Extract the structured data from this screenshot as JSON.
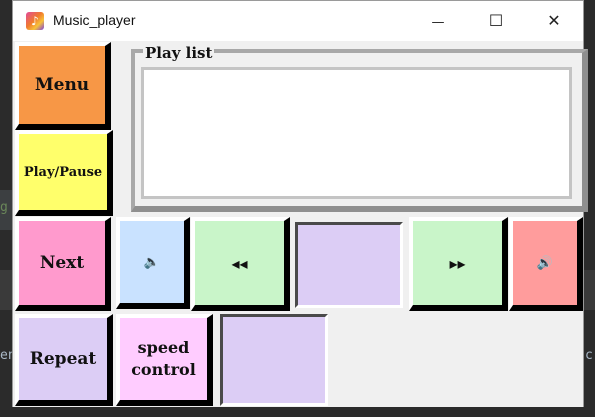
{
  "window": {
    "title": "Music_player",
    "app_icon": "music-note-icon",
    "minimize_glyph": "—",
    "maximize_glyph": "☐",
    "close_glyph": "✕"
  },
  "background": {
    "left_letter_1": "g",
    "left_letter_2": "en",
    "right_letter": "c"
  },
  "playlist": {
    "label": "Play list",
    "items": []
  },
  "buttons": {
    "menu": "Menu",
    "play_pause": "Play/Pause",
    "next": "Next",
    "repeat": "Repeat",
    "speed_line1": "speed",
    "speed_line2": "control",
    "volume_down_icon": "speaker-low-icon",
    "rewind": "◂◂",
    "forward": "▸▸",
    "volume_up_icon": "speaker-high-icon"
  },
  "colors": {
    "menu": "#f79746",
    "play_pause": "#ffff6b",
    "next": "#ff9acd",
    "volume_down": "#c9e2ff",
    "seek": "#c9f5c9",
    "volume_up": "#ff9c9c",
    "repeat": "#dccdf5",
    "speed": "#ffccff",
    "panel": "#dccdf5"
  }
}
